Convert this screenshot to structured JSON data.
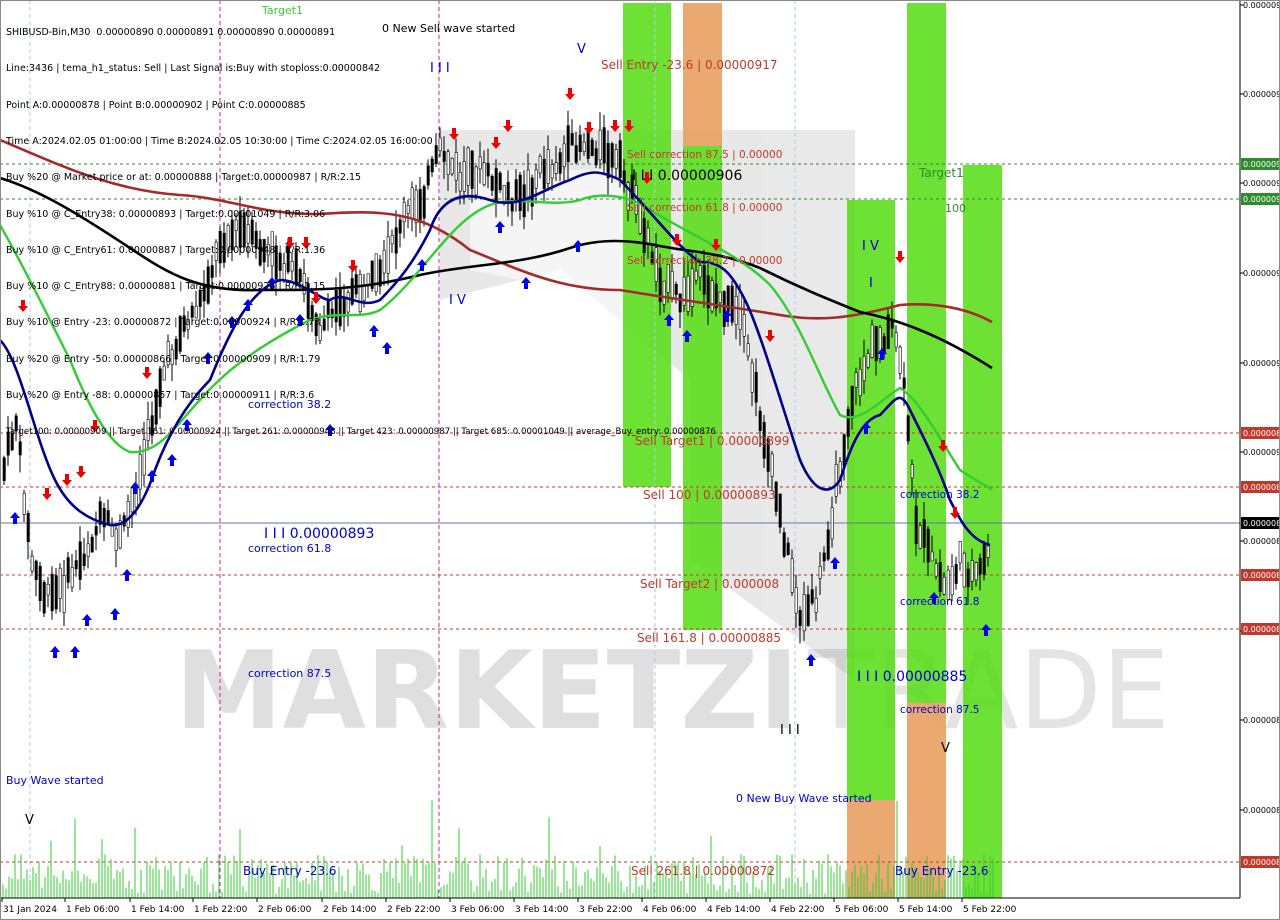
{
  "header": {
    "symbol_line": "SHIBUSD-Bin,M30  0.00000890 0.00000891 0.00000890 0.00000891",
    "info_lines": [
      "Line:3436 | tema_h1_status: Sell | Last Signal is:Buy with stoploss:0.00000842",
      "Point A:0.00000878 | Point B:0.00000902 | Point C:0.00000885",
      "Time A:2024.02.05 01:00:00 | Time B:2024.02.05 10:30:00 | Time C:2024.02.05 16:00:00",
      "Buy %20 @ Market price or at: 0.00000888 | Target:0.00000987 | R/R:2.15",
      "Buy %10 @ C_Entry38: 0.00000893 | Target:0.00001049 | R/R:3.06",
      "Buy %10 @ C_Entry61: 0.00000887 | Target:0.00000948 | R/R:1.36",
      "Buy %10 @ C_Entry88: 0.00000881 | Target:0.00000926 | R/R:1.15",
      "Buy %10 @ Entry -23: 0.00000872 | Target:0.00000924 | R/R:1.73",
      "Buy %20 @ Entry -50: 0.00000866 | Target:0.00000909 | R/R:1.79",
      "Buy %20 @ Entry -88: 0.00000857 | Target:0.00000911 | R/R:3.6",
      "Target100: 0.00000909 || Target 161: 0.00000924 || Target 261: 0.00000948 || Target 423: 0.00000987 || Target 685: 0.00001049 || average_Buy_entry: 0.00000876"
    ]
  },
  "watermark": {
    "bold": "MARKETZI",
    "light": "TRADE"
  },
  "colors": {
    "green_zone": "#55dd11",
    "orange_zone": "#e8a060",
    "sell_text": "#c0392b",
    "buy_text": "#0000cc",
    "ma_red": "#a52a2a",
    "ma_black": "#000000",
    "ma_green": "#33cc33",
    "ma_blue": "#00008b",
    "volume": "#33cc33"
  },
  "annotations": {
    "sell_wave": "0 New Sell wave started",
    "buy_wave": "0 New Buy Wave started",
    "buy_wave_start": "Buy Wave started",
    "sell_entry": "Sell Entry -23.6 | 0.00000917",
    "sell_corr_875": "Sell correction 87.5 | 0.00000",
    "sell_corr_618": "Sell correction 61.8 | 0.00000",
    "sell_corr_382": "Sell correction 38.2 | 0.00000",
    "sell_level_906": "I I I 0.00000906",
    "sell_target1": "Sell Target1 | 0.00000899",
    "sell_100": "Sell 100 | 0.00000893",
    "sell_target2": "Sell Target2 | 0.000008",
    "sell_1618": "Sell 161.8 | 0.00000885",
    "sell_2618": "Sell  261.8 | 0.00000872",
    "buy_level_893": "I I I 0.00000893",
    "buy_level_885": "I I I 0.00000885",
    "corr_382_a": "correction 38.2",
    "corr_618_a": "correction 61.8",
    "corr_875_a": "correction 87.5",
    "corr_382_b": "correction 38.2",
    "corr_618_b": "correction 61.8",
    "corr_875_b": "correction 87.5",
    "buy_entry_a": "Buy Entry -23.6",
    "buy_entry_b": "Buy Entry -23.6",
    "target1": "Target1",
    "t100": "100",
    "target1_top": "Target1",
    "wave_iii_top": "I I I",
    "wave_iv_a": "I V",
    "wave_v_top": "V",
    "wave_iv_b": "I V",
    "wave_i_b": "I",
    "wave_v_bottom": "V",
    "wave_v_left": "V",
    "wave_iii_bottom": "I I I"
  },
  "price_axis": {
    "right_labels": [
      "0.000009",
      "0.000009",
      "0.000009",
      "0.000009",
      "0.000009",
      "0.000009",
      "0.000008",
      "0.000008",
      "0.000008",
      "0.000008",
      "0.000008"
    ],
    "highlighted_labels": [
      {
        "text": "0.000009",
        "kind": "green"
      },
      {
        "text": "0.000009",
        "kind": "green"
      },
      {
        "text": "0.000008",
        "kind": "red"
      },
      {
        "text": "0.000008",
        "kind": "red"
      },
      {
        "text": "0.000008",
        "kind": "current"
      },
      {
        "text": "0.000008",
        "kind": "red"
      },
      {
        "text": "0.000008",
        "kind": "red"
      },
      {
        "text": "0.000008",
        "kind": "red"
      }
    ]
  },
  "chart_data": {
    "type": "candlestick",
    "symbol": "SHIBUSD-Bin",
    "timeframe": "M30",
    "x_ticks": [
      "31 Jan 2024",
      "1 Feb 06:00",
      "1 Feb 14:00",
      "1 Feb 22:00",
      "2 Feb 06:00",
      "2 Feb 14:00",
      "2 Feb 22:00",
      "3 Feb 06:00",
      "3 Feb 14:00",
      "3 Feb 22:00",
      "4 Feb 06:00",
      "4 Feb 14:00",
      "4 Feb 22:00",
      "5 Feb 06:00",
      "5 Feb 14:00",
      "5 Feb 22:00"
    ],
    "ylim": [
      8.68e-06,
      9.29e-06
    ],
    "current_price": 8.91e-06,
    "levels": [
      {
        "name": "Target1",
        "value": 9.18e-06
      },
      {
        "name": "Target 100",
        "value": 9.16e-06
      },
      {
        "name": "Sell Target1",
        "value": 8.99e-06
      },
      {
        "name": "Sell 100",
        "value": 8.93e-06
      },
      {
        "name": "Sell Target2",
        "value": 8.89e-06
      },
      {
        "name": "Sell 161.8",
        "value": 8.85e-06
      },
      {
        "name": "Sell 261.8",
        "value": 8.72e-06
      }
    ],
    "grid": false
  }
}
